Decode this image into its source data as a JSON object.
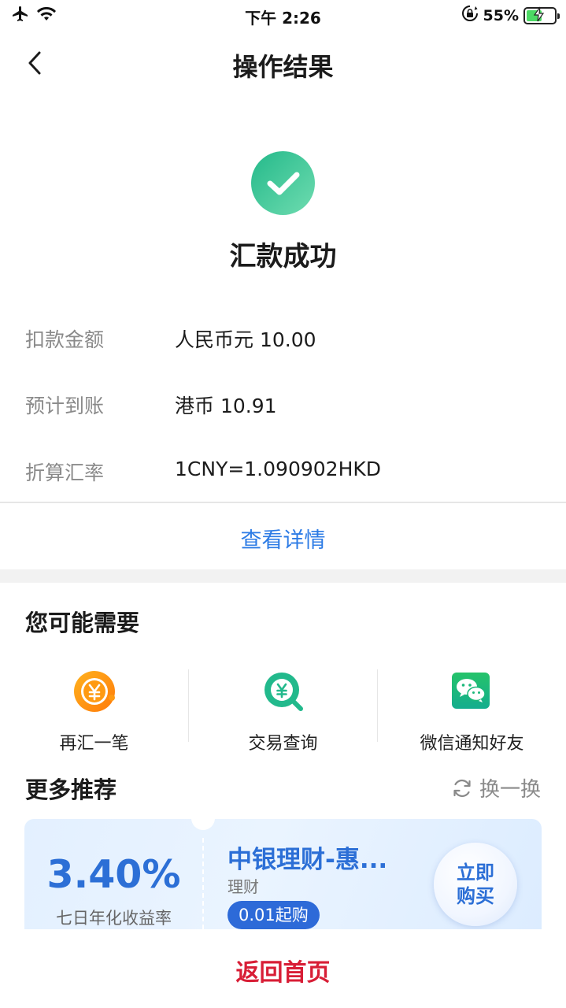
{
  "status_bar": {
    "time": "下午 2:26",
    "battery_percent": "55%",
    "battery_level": 0.55,
    "icons": [
      "airplane-icon",
      "wifi-icon",
      "orientation-lock-icon",
      "battery-icon"
    ]
  },
  "nav": {
    "title": "操作结果",
    "back_icon": "chevron-left-icon"
  },
  "result": {
    "title": "汇款成功",
    "icon": "check-circle-icon",
    "color": "#24b98a"
  },
  "details": [
    {
      "label": "扣款金额",
      "value": "人民币元 10.00"
    },
    {
      "label": "预计到账",
      "value": "港币 10.91"
    },
    {
      "label": "折算汇率",
      "value": "1CNY=1.090902HKD"
    }
  ],
  "view_detail_label": "查看详情",
  "maybe_need": {
    "title": "您可能需要",
    "items": [
      {
        "label": "再汇一笔",
        "icon": "yuan-coin-icon"
      },
      {
        "label": "交易查询",
        "icon": "yuan-search-icon"
      },
      {
        "label": "微信通知好友",
        "icon": "wechat-icon"
      }
    ]
  },
  "more": {
    "title": "更多推荐",
    "refresh_label": "换一换",
    "refresh_icon": "refresh-icon"
  },
  "product": {
    "rate": "3.40%",
    "rate_label": "七日年化收益率",
    "name": "中银理财-惠...",
    "type": "理财",
    "badge": "0.01起购",
    "buy_line1": "立即",
    "buy_line2": "购买"
  },
  "bottom": {
    "home_label": "返回首页"
  },
  "colors": {
    "accent_blue": "#2c7be5",
    "success_green": "#24b98a",
    "home_red": "#d81e36"
  }
}
